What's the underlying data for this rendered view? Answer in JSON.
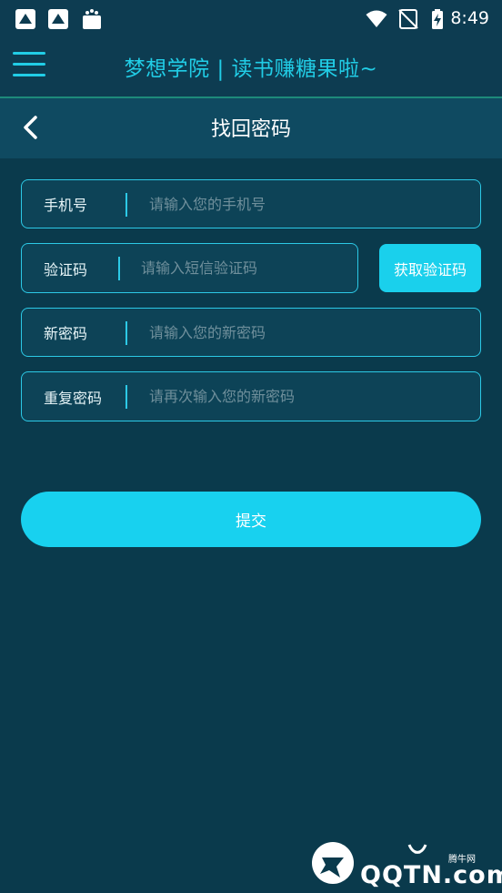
{
  "status_bar": {
    "time": "8:49"
  },
  "app_bar": {
    "title": "梦想学院 | 读书赚糖果啦~"
  },
  "sub_header": {
    "title": "找回密码"
  },
  "form": {
    "phone": {
      "label": "手机号",
      "placeholder": "请输入您的手机号",
      "value": ""
    },
    "code": {
      "label": "验证码",
      "placeholder": "请输入短信验证码",
      "value": ""
    },
    "get_code_button": "获取验证码",
    "new_password": {
      "label": "新密码",
      "placeholder": "请输入您的新密码",
      "value": ""
    },
    "repeat_password": {
      "label": "重复密码",
      "placeholder": "请再次输入您的新密码",
      "value": ""
    },
    "submit_button": "提交"
  },
  "watermark": {
    "brand": "QQTN.com",
    "small": "腾牛网"
  },
  "colors": {
    "accent": "#1ad0ec",
    "background": "#0a3a4c",
    "header": "#0d3c51"
  }
}
